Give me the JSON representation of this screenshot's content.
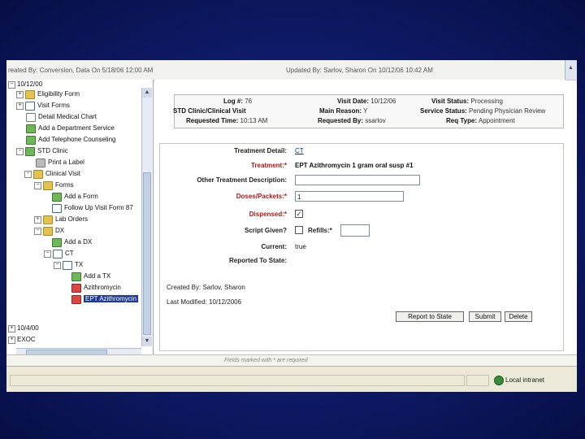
{
  "header": {
    "created": "reated By: Conversion, Data On 5/18/06 12:00 AM",
    "updated": "Updated By: Sarlov, Sharon On 10/12/06 10:42 AM"
  },
  "tree": {
    "root_label": "10/12/00",
    "items": [
      {
        "label": "Eligibility Form"
      },
      {
        "label": "Visit Forms"
      },
      {
        "label": "Detail Medical Chart"
      },
      {
        "label": "Add a Department Service"
      },
      {
        "label": "Add Telephone Counseling"
      },
      {
        "label": "STD Clinic"
      },
      {
        "label": "Print a Label"
      },
      {
        "label": "Clinical Visit"
      },
      {
        "label": "Forms"
      },
      {
        "label": "Add a Form"
      },
      {
        "label": "Follow Up Visit Form 87"
      },
      {
        "label": "Lab Orders"
      },
      {
        "label": "DX"
      },
      {
        "label": "Add a DX"
      },
      {
        "label": "CT"
      },
      {
        "label": "TX"
      },
      {
        "label": "Add a TX"
      },
      {
        "label": "Azithromycin"
      },
      {
        "label": "EPT Azithromycin"
      },
      {
        "label": "10/4/00"
      },
      {
        "label": "EXOC"
      }
    ]
  },
  "visit": {
    "log_label": "Log #:",
    "log_value": "76",
    "visit_date_label": "Visit Date:",
    "visit_date_value": "10/12/06",
    "visit_status_label": "Visit Status:",
    "visit_status_value": "Processing",
    "clinic_label": "STD Clinic/Clinical Visit",
    "main_reason_label": "Main Reason:",
    "main_reason_value": "Y",
    "service_status_label": "Service Status:",
    "service_status_value": "Pending Physician Review",
    "requested_time_label": "Requested Time:",
    "requested_time_value": "10:13 AM",
    "requested_by_label": "Requested By:",
    "requested_by_value": "ssarlov",
    "req_type_label": "Req Type:",
    "req_type_value": "Appointment"
  },
  "treatment": {
    "detail_label": "Treatment Detail:",
    "detail_value": "CT",
    "treatment_label": "Treatment:*",
    "treatment_value": "EPT Azithromycin 1 gram oral susp #1",
    "other_desc_label": "Other Treatment Description:",
    "other_desc_value": "",
    "doses_label": "Doses/Packets:*",
    "doses_value": "1",
    "dispensed_label": "Dispensed:*",
    "dispensed_check": "✓",
    "script_label": "Script Given?",
    "refills_label": "Refills:*",
    "refills_value": "",
    "current_label": "Current:",
    "current_value": "true",
    "reported_label": "Reported To State:",
    "reported_value": "",
    "created_by": "Created By: Sarlov, Sharon",
    "last_modified": "Last Modified: 10/12/2006"
  },
  "buttons": {
    "report": "Report to State",
    "submit": "Submit",
    "delete": "Delete"
  },
  "footer": {
    "note": "Fields marked with * are required",
    "zone": "Local intranet"
  }
}
